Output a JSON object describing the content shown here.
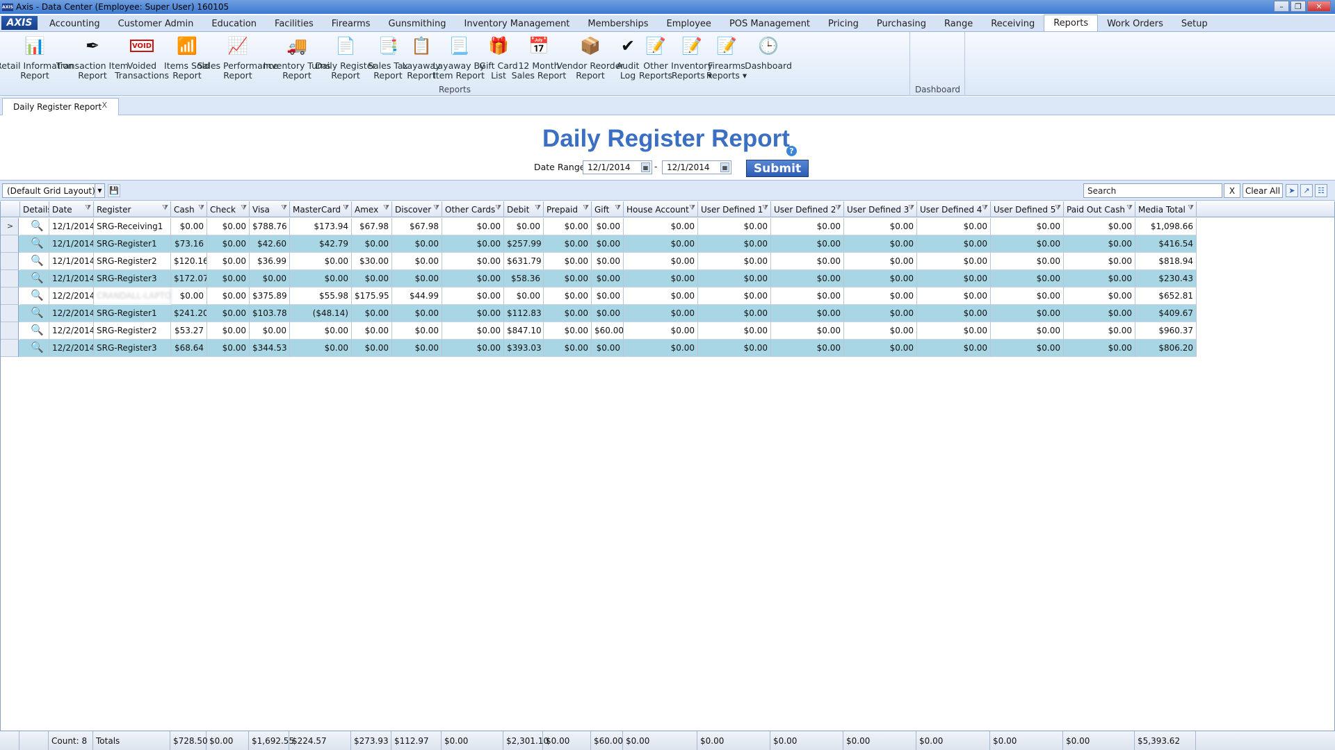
{
  "window": {
    "title": "Axis - Data Center  (Employee: Super User) 160105",
    "logo_text": "AXIS"
  },
  "menu": {
    "brand": "AXIS",
    "items": [
      "Accounting",
      "Customer Admin",
      "Education",
      "Facilities",
      "Firearms",
      "Gunsmithing",
      "Inventory Management",
      "Memberships",
      "Employee",
      "POS Management",
      "Pricing",
      "Purchasing",
      "Range",
      "Receiving",
      "Reports",
      "Work Orders",
      "Setup"
    ],
    "active": "Reports"
  },
  "ribbon": {
    "groups": {
      "reports": "Reports",
      "dashboard": "Dashboard"
    },
    "buttons": [
      {
        "label": "Retail Information\nReport",
        "icon": "document-chart-icon"
      },
      {
        "label": "Transaction Item\nReport",
        "icon": "pen-nib-icon"
      },
      {
        "label": "Voided\nTransactions",
        "icon": "void-stamp-icon",
        "icon_text": "VOID"
      },
      {
        "label": "Items Sold\nReport",
        "icon": "bar-chart-icon"
      },
      {
        "label": "Sales Performance\nReport",
        "icon": "sales-chart-icon"
      },
      {
        "label": "Inventory Turns\nReport",
        "icon": "inventory-truck-icon"
      },
      {
        "label": "Daily Register\nReport",
        "icon": "register-report-icon"
      },
      {
        "label": "Sales Tax\nReport",
        "icon": "tax-report-icon"
      },
      {
        "label": "Layaway\nReport",
        "icon": "layaway-report-icon"
      },
      {
        "label": "Layaway By\nItem Report",
        "icon": "layaway-item-icon"
      },
      {
        "label": "Gift Card\nList",
        "icon": "gift-card-icon"
      },
      {
        "label": "12 Month\nSales Report",
        "icon": "calendar-icon"
      },
      {
        "label": "Vendor Reorder\nReport",
        "icon": "vendor-reorder-icon"
      },
      {
        "label": "Audit\nLog",
        "icon": "audit-check-icon"
      },
      {
        "label": "Other\nReports",
        "icon": "other-reports-icon"
      },
      {
        "label": "Inventory\nReports ▾",
        "icon": "inventory-reports-icon"
      },
      {
        "label": "Firearms\nReports ▾",
        "icon": "firearms-reports-icon"
      },
      {
        "label": "Dashboard",
        "icon": "dashboard-gauge-icon"
      }
    ]
  },
  "doc_tab": {
    "label": "Daily Register Report",
    "close": "X"
  },
  "report": {
    "title": "Daily Register Report",
    "help": "?",
    "date_range_label": "Date Range:",
    "date_from": "12/1/2014",
    "date_to": "12/1/2014",
    "date_separator": "-",
    "submit_label": "Submit"
  },
  "grid_toolbar": {
    "layout": "(Default Grid Layout)",
    "search_placeholder": "Search",
    "search_clear": "X",
    "clear_all": "Clear All"
  },
  "grid": {
    "columns": [
      "Details",
      "Date",
      "Register",
      "Cash",
      "Check",
      "Visa",
      "MasterCard",
      "Amex",
      "Discover",
      "Other Cards",
      "Debit",
      "Prepaid",
      "Gift",
      "House Account",
      "User Defined 1",
      "User Defined 2",
      "User Defined 3",
      "User Defined 4",
      "User Defined 5",
      "Paid Out Cash",
      "Media Total"
    ],
    "rows": [
      {
        "date": "12/1/2014",
        "register": "SRG-Receiving1",
        "blurred": false,
        "v": [
          "$0.00",
          "$0.00",
          "$788.76",
          "$173.94",
          "$67.98",
          "$67.98",
          "$0.00",
          "$0.00",
          "$0.00",
          "$0.00",
          "$0.00",
          "$0.00",
          "$0.00",
          "$0.00",
          "$0.00",
          "$0.00",
          "$0.00",
          "$1,098.66"
        ]
      },
      {
        "date": "12/1/2014",
        "register": "SRG-Register1",
        "blurred": false,
        "v": [
          "$73.16",
          "$0.00",
          "$42.60",
          "$42.79",
          "$0.00",
          "$0.00",
          "$0.00",
          "$257.99",
          "$0.00",
          "$0.00",
          "$0.00",
          "$0.00",
          "$0.00",
          "$0.00",
          "$0.00",
          "$0.00",
          "$0.00",
          "$416.54"
        ]
      },
      {
        "date": "12/1/2014",
        "register": "SRG-Register2",
        "blurred": false,
        "v": [
          "$120.16",
          "$0.00",
          "$36.99",
          "$0.00",
          "$30.00",
          "$0.00",
          "$0.00",
          "$631.79",
          "$0.00",
          "$0.00",
          "$0.00",
          "$0.00",
          "$0.00",
          "$0.00",
          "$0.00",
          "$0.00",
          "$0.00",
          "$818.94"
        ]
      },
      {
        "date": "12/1/2014",
        "register": "SRG-Register3",
        "blurred": false,
        "v": [
          "$172.07",
          "$0.00",
          "$0.00",
          "$0.00",
          "$0.00",
          "$0.00",
          "$0.00",
          "$58.36",
          "$0.00",
          "$0.00",
          "$0.00",
          "$0.00",
          "$0.00",
          "$0.00",
          "$0.00",
          "$0.00",
          "$0.00",
          "$230.43"
        ]
      },
      {
        "date": "12/2/2014",
        "register": "CRANDALL-LAPTOP",
        "blurred": true,
        "v": [
          "$0.00",
          "$0.00",
          "$375.89",
          "$55.98",
          "$175.95",
          "$44.99",
          "$0.00",
          "$0.00",
          "$0.00",
          "$0.00",
          "$0.00",
          "$0.00",
          "$0.00",
          "$0.00",
          "$0.00",
          "$0.00",
          "$0.00",
          "$652.81"
        ]
      },
      {
        "date": "12/2/2014",
        "register": "SRG-Register1",
        "blurred": false,
        "v": [
          "$241.20",
          "$0.00",
          "$103.78",
          "($48.14)",
          "$0.00",
          "$0.00",
          "$0.00",
          "$112.83",
          "$0.00",
          "$0.00",
          "$0.00",
          "$0.00",
          "$0.00",
          "$0.00",
          "$0.00",
          "$0.00",
          "$0.00",
          "$409.67"
        ]
      },
      {
        "date": "12/2/2014",
        "register": "SRG-Register2",
        "blurred": false,
        "v": [
          "$53.27",
          "$0.00",
          "$0.00",
          "$0.00",
          "$0.00",
          "$0.00",
          "$0.00",
          "$847.10",
          "$0.00",
          "$60.00",
          "$0.00",
          "$0.00",
          "$0.00",
          "$0.00",
          "$0.00",
          "$0.00",
          "$0.00",
          "$960.37"
        ]
      },
      {
        "date": "12/2/2014",
        "register": "SRG-Register3",
        "blurred": false,
        "v": [
          "$68.64",
          "$0.00",
          "$344.53",
          "$0.00",
          "$0.00",
          "$0.00",
          "$0.00",
          "$393.03",
          "$0.00",
          "$0.00",
          "$0.00",
          "$0.00",
          "$0.00",
          "$0.00",
          "$0.00",
          "$0.00",
          "$0.00",
          "$806.20"
        ]
      }
    ],
    "current_row_marker": ">",
    "footer": {
      "count": "Count: 8",
      "totals_label": "Totals",
      "v": [
        "$728.50",
        "$0.00",
        "$1,692.55",
        "$224.57",
        "$273.93",
        "$112.97",
        "$0.00",
        "$2,301.10",
        "$0.00",
        "$60.00",
        "$0.00",
        "$0.00",
        "$0.00",
        "$0.00",
        "$0.00",
        "$0.00",
        "$0.00",
        "$5,393.62"
      ]
    }
  }
}
